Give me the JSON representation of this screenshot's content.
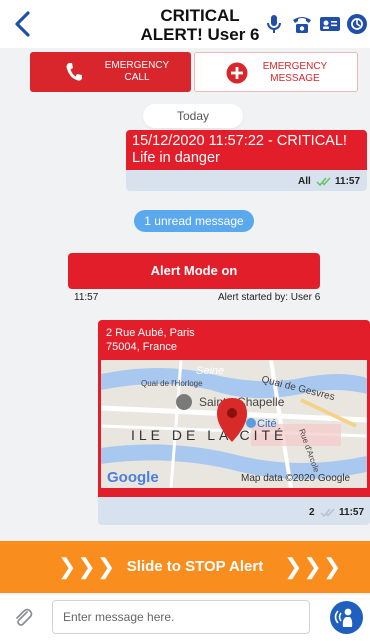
{
  "header": {
    "title_line1": "CRITICAL",
    "title_line2": "ALERT! User 6"
  },
  "emergency": {
    "call_line1": "EMERGENCY",
    "call_line2": "CALL",
    "msg_line1": "EMERGENCY",
    "msg_line2": "MESSAGE"
  },
  "chat": {
    "date_divider": "Today",
    "message1": {
      "text_line1": "15/12/2020 11:57:22 - CRITICAL!",
      "text_line2": "Life in danger",
      "recipients": "All",
      "time": "11:57"
    },
    "unread_badge": "1 unread message",
    "alert_mode": {
      "label": "Alert Mode on",
      "time": "11:57",
      "started_by": "Alert started by: User 6"
    },
    "location_message": {
      "address_line1": "2 Rue Aubé, Paris",
      "address_line2": "75004, France",
      "map_labels": {
        "seine": "Seine",
        "quai_gesvres": "Quai de Gesvres",
        "quai_horloge": "Quai de l'Horloge",
        "sainte_chapelle": "Sainte-Chapelle",
        "cite": "Cité",
        "ile": "ILE DE LA CITÉ",
        "arcole": "Rue d'Arcole"
      },
      "google": "Google",
      "map_credit": "Map data ©2020 Google",
      "read_count": "2",
      "time": "11:57"
    }
  },
  "slide": {
    "label": "Slide to STOP Alert",
    "chevrons": "❯❯❯"
  },
  "composer": {
    "placeholder": "Enter message here."
  },
  "colors": {
    "alert_red": "#e21e2a",
    "orange": "#f98e1e",
    "blue": "#1f5fbf"
  }
}
